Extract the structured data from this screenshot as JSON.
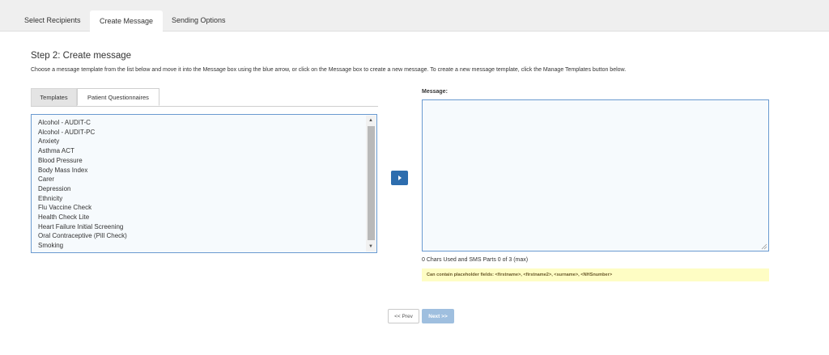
{
  "tabs": [
    {
      "label": "Select Recipients",
      "active": false
    },
    {
      "label": "Create Message",
      "active": true
    },
    {
      "label": "Sending Options",
      "active": false
    }
  ],
  "step_title": "Step 2: Create message",
  "instructions": "Choose a message template from the list below and move it into the Message box using the blue arrow, or click on the Message box to create a new message. To create a new message template, click the Manage Templates button below.",
  "template_tabs": [
    {
      "label": "Templates",
      "active": false
    },
    {
      "label": "Patient Questionnaires",
      "active": true
    }
  ],
  "questionnaires": [
    "Alcohol - AUDIT-C",
    "Alcohol - AUDIT-PC",
    "Anxiety",
    "Asthma ACT",
    "Blood Pressure",
    "Body Mass Index",
    "Carer",
    "Depression",
    "Ethnicity",
    "Flu Vaccine Check",
    "Health Check Lite",
    "Heart Failure Initial Screening",
    "Oral Contraceptive (Pill Check)",
    "Smoking"
  ],
  "message": {
    "label": "Message:",
    "value": "",
    "chars_info": "0 Chars Used and SMS Parts 0 of 3 (max)",
    "placeholder_note": "Can contain placeholder fields: <firstname>, <firstname2>, <surname>, <NHSnumber>"
  },
  "nav": {
    "prev": "<< Prev",
    "next": "Next >>"
  },
  "colors": {
    "accent": "#2d6dae",
    "box_border": "#6a9ad0",
    "note_bg": "#fefdc4",
    "next_disabled": "#9fbfdf"
  }
}
